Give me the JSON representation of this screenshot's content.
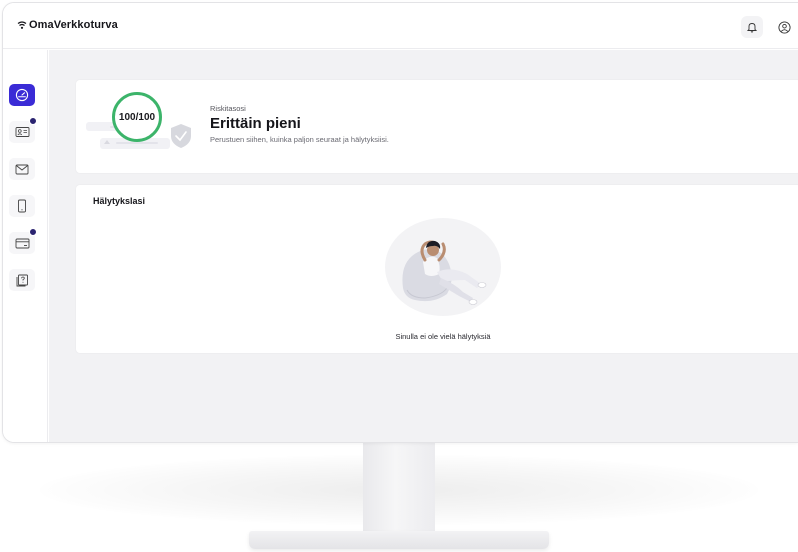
{
  "app": {
    "brand": "OmaVerkkoturva"
  },
  "header": {
    "notifications_icon": "bell-icon",
    "profile_icon": "user-circle-icon"
  },
  "sidebar": {
    "items": [
      {
        "icon": "gauge-icon",
        "active": true,
        "badge": false
      },
      {
        "icon": "id-card-icon",
        "active": false,
        "badge": true
      },
      {
        "icon": "mail-icon",
        "active": false,
        "badge": false
      },
      {
        "icon": "phone-icon",
        "active": false,
        "badge": false
      },
      {
        "icon": "credit-card-icon",
        "active": false,
        "badge": true
      },
      {
        "icon": "help-document-icon",
        "active": false,
        "badge": false
      }
    ]
  },
  "risk": {
    "score": "100/100",
    "label": "Riskitasosi",
    "level": "Erittäin pieni",
    "description": "Perustuen siihen, kuinka paljon seuraat ja hälytyksiisi.",
    "help": "?"
  },
  "alerts": {
    "title": "Hälytykslasi",
    "empty_message": "Sinulla ei ole vielä hälytyksiä"
  },
  "colors": {
    "accent": "#3a2bd6",
    "score_ring": "#3cb46a",
    "badge": "#2a2370",
    "content_bg": "#f2f2f4"
  }
}
